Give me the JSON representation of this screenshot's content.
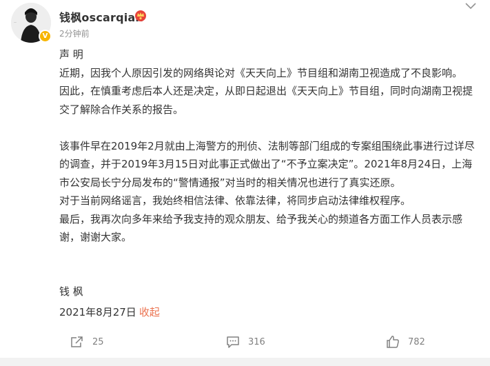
{
  "post": {
    "username": "钱枫oscarqian",
    "time": "2分钟前",
    "paragraphs": [
      "声 明",
      "近期，因我个人原因引发的网络舆论对《天天向上》节目组和湖南卫视造成了不良影响。",
      "因此，在慎重考虑后本人还是决定，从即日起退出《天天向上》节目组，同时向湖南卫视提交了解除合作关系的报告。",
      "",
      "该事件早在2019年2月就由上海警方的刑侦、法制等部门组成的专案组围绕此事进行过详尽的调查，并于2019年3月15日对此事正式做出了“不予立案决定”。2021年8月24日，上海市公安局长宁分局发布的“警情通报”对当时的相关情况也进行了真实还原。",
      "对于当前网络谣言，我始终相信法律、依靠法律，将同步启动法律维权程序。",
      "最后，我再次向多年来给予我支持的观众朋友、给予我关心的频道各方面工作人员表示感谢，谢谢大家。"
    ],
    "signature": "钱 枫",
    "date": "2021年8月27日",
    "collapse_label": "收起"
  },
  "actions": {
    "repost_count": "25",
    "comment_count": "316",
    "like_count": "782"
  },
  "icons": {
    "badge": "verified-v-icon",
    "crown": "crown-icon",
    "more": "chevron-down-icon",
    "repost": "share-icon",
    "comment": "comment-icon",
    "like": "thumbs-up-icon"
  },
  "colors": {
    "text": "#333333",
    "muted": "#939393",
    "link": "#eb7350",
    "badge": "#f7b500"
  }
}
